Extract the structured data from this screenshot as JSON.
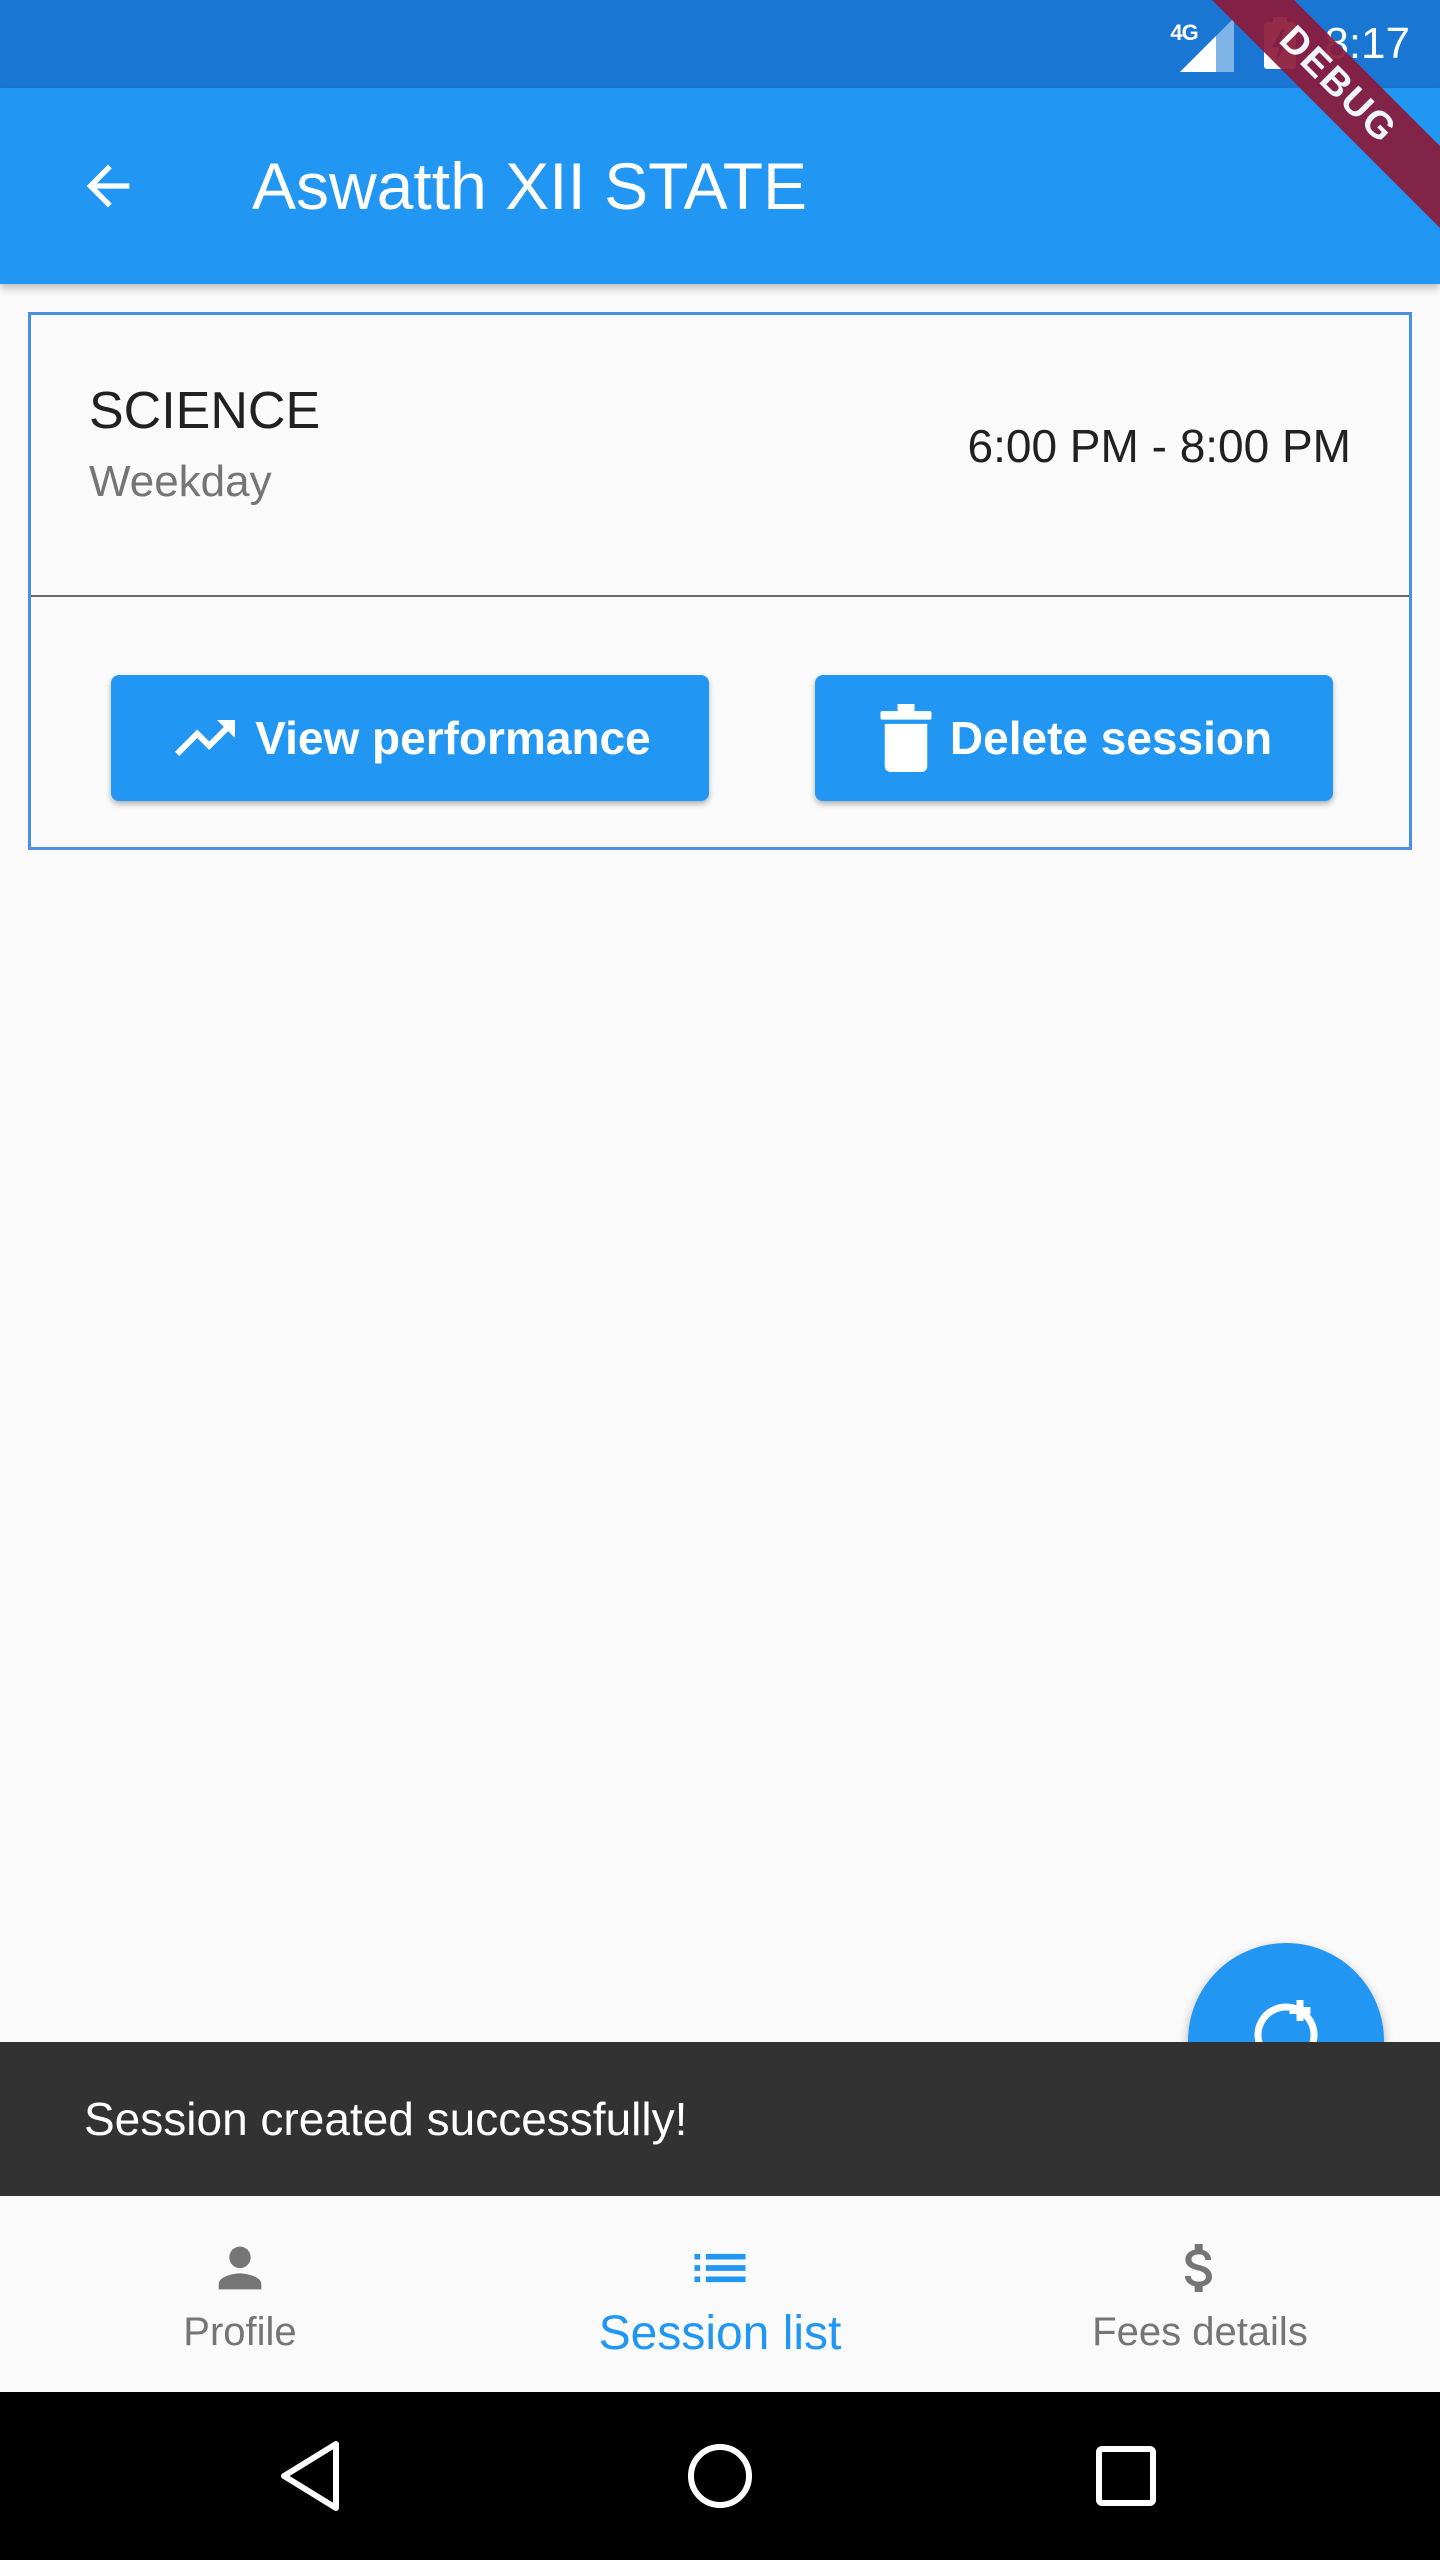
{
  "status_bar": {
    "network": "4G",
    "time": "8:17",
    "debug_banner": "DEBUG"
  },
  "app_bar": {
    "title": "Aswatth XII STATE"
  },
  "session": {
    "subject": "SCIENCE",
    "day_type": "Weekday",
    "time_range": "6:00 PM - 8:00 PM",
    "view_performance_label": "View performance",
    "delete_session_label": "Delete session"
  },
  "snackbar": {
    "message": "Session created successfully!"
  },
  "bottom_nav": {
    "items": [
      {
        "label": "Profile",
        "icon": "person-icon"
      },
      {
        "label": "Session list",
        "icon": "list-icon"
      },
      {
        "label": "Fees details",
        "icon": "dollar-icon"
      }
    ],
    "active_index": 1
  },
  "colors": {
    "primary": "#2196f3",
    "status_bar": "#1976d2",
    "snackbar_bg": "#323232",
    "card_border": "#4a90e2",
    "debug_ribbon": "#8b1a3a"
  }
}
